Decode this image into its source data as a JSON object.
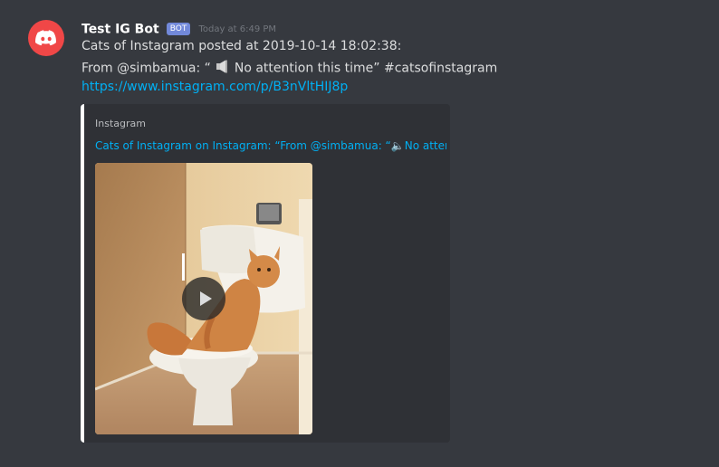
{
  "message": {
    "author": "Test IG Bot",
    "bot_tag": "BOT",
    "timestamp": "Today at 6:49 PM",
    "line1": "Cats of Instagram posted at 2019-10-14 18:02:38:",
    "line2_before": "From @simbamua: “ ",
    "speaker_icon": "speaker-icon",
    "line2_after": " No attention this time” #catsofinstagram",
    "link": "https://www.instagram.com/p/B3nVltHIJ8p"
  },
  "embed": {
    "provider": "Instagram",
    "title": "Cats of Instagram on Instagram: “From @simbamua: “🔈No atten...",
    "media_icon": "play-icon"
  },
  "colors": {
    "background": "#36393f",
    "embed_bg": "#2f3136",
    "link": "#00b0f4",
    "bot_tag": "#7289da",
    "avatar": "#f04747"
  }
}
